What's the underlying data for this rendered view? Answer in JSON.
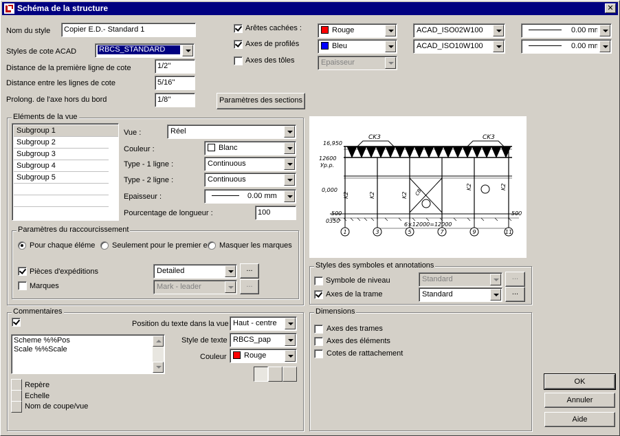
{
  "window": {
    "title": "Schéma de la structure",
    "close_glyph": "✕"
  },
  "style": {
    "name_label": "Nom du style",
    "name_value": "Copier E.D.- Standard 1",
    "acad_label": "Styles de cote ACAD",
    "acad_value": "RBCS_STANDARD",
    "dist_first_label": "Distance de la première ligne de cote",
    "dist_first_value": "1/2''",
    "dist_between_label": "Distance entre les lignes de cote",
    "dist_between_value": "5/16''",
    "prolong_label": "Prolong. de l'axe hors du bord",
    "prolong_value": "1/8''",
    "sections_button": "Paramètres des sections"
  },
  "edges": {
    "hidden": {
      "label": "Arêtes cachées :",
      "checked": true,
      "color": "Rouge",
      "color_hex": "#ff0000",
      "linetype": "ACAD_ISO02W100",
      "weight": "0.00 mm"
    },
    "profiles": {
      "label": "Axes de profilés",
      "checked": true,
      "color": "Bleu",
      "color_hex": "#0000ff",
      "linetype": "ACAD_ISO10W100",
      "weight": "0.00 mm"
    },
    "sheets": {
      "label": "Axes des tôles",
      "checked": false,
      "thickness": "Epaisseur"
    }
  },
  "view_elements": {
    "title": "Eléments de la vue",
    "subgroups": [
      "Subgroup 1",
      "Subgroup 2",
      "Subgroup 3",
      "Subgroup 4",
      "Subgroup 5"
    ],
    "view_label": "Vue :",
    "view_value": "Réel",
    "color_label": "Couleur :",
    "color_value": "Blanc",
    "color_hex": "#ffffff",
    "type1_label": "Type - 1 ligne :",
    "type1_value": "Continuous",
    "type2_label": "Type - 2 ligne :",
    "type2_value": "Continuous",
    "thickness_label": "Epaisseur :",
    "thickness_value": "0.00 mm",
    "length_label": "Pourcentage de longueur :",
    "length_value": "100"
  },
  "shortening": {
    "title": "Paramètres du raccourcissement",
    "radio1": "Pour chaque éléme",
    "radio2": "Seulement pour le premier e",
    "radio3": "Masquer les marques",
    "shipping_label": "Pièces d'expéditions",
    "shipping_value": "Detailed",
    "marks_label": "Marques",
    "marks_value": "Mark - leader",
    "more": "..."
  },
  "symbols": {
    "title": "Styles des symboles et annotations",
    "level_label": "Symbole de niveau",
    "level_value": "Standard",
    "grid_label": "Axes de la trame",
    "grid_value": "Standard",
    "more": "..."
  },
  "comments": {
    "title": "Commentaires",
    "position_label": "Position du texte dans la vue",
    "position_value": "Haut - centre",
    "style_label": "Style de texte",
    "style_value": "RBCS_pap",
    "color_label": "Couleur",
    "color_value": "Rouge",
    "color_hex": "#ff0000",
    "lines": [
      "Scheme %%Pos",
      "Scale %%Scale"
    ],
    "btn_mark": "Repère",
    "btn_echelle": "Echelle",
    "btn_section": "Nom de coupe/vue"
  },
  "dimensions": {
    "title": "Dimensions",
    "grid": "Axes des trames",
    "elements": "Axes des éléments",
    "attach": "Cotes de rattachement"
  },
  "preview": {
    "ck_left": "CK3",
    "ck_right": "CK3",
    "elev_top": "16,950",
    "elev_mid": "12600",
    "elev_sub": "Ур.р.",
    "elev_zero": "0,000",
    "base_left": "500",
    "base_left2": "0350",
    "base_right": "500",
    "span": "6×12000=12000",
    "axes": [
      "1",
      "3",
      "5",
      "7",
      "9",
      "11"
    ],
    "k2": "K2",
    "col_sign": "CB"
  },
  "buttons": {
    "ok": "OK",
    "cancel": "Annuler",
    "help": "Aide"
  }
}
